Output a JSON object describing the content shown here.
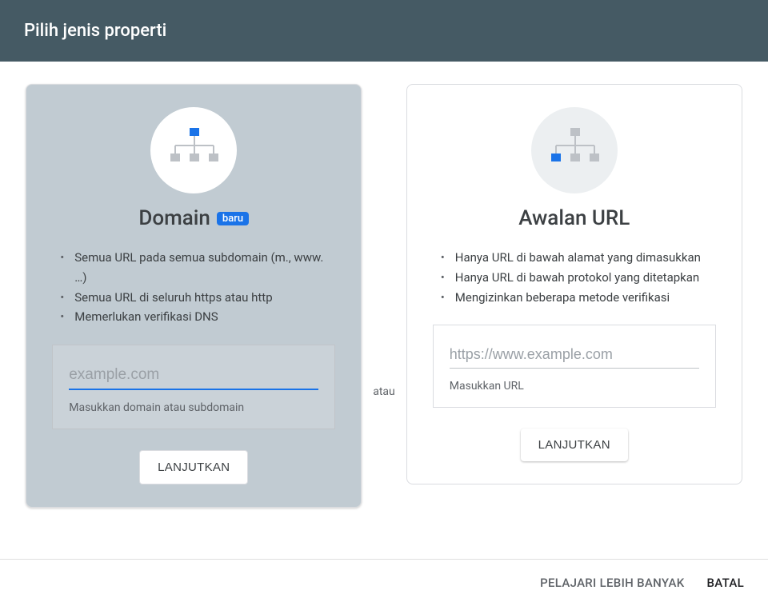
{
  "header": {
    "title": "Pilih jenis properti"
  },
  "separator": "atau",
  "domain_card": {
    "title": "Domain",
    "badge": "baru",
    "bullets": [
      "Semua URL pada semua subdomain (m., www. …)",
      "Semua URL di seluruh https atau http",
      "Memerlukan verifikasi DNS"
    ],
    "placeholder": "example.com",
    "helper": "Masukkan domain atau subdomain",
    "button": "LANJUTKAN"
  },
  "url_card": {
    "title": "Awalan URL",
    "bullets": [
      "Hanya URL di bawah alamat yang dimasukkan",
      "Hanya URL di bawah protokol yang ditetapkan",
      "Mengizinkan beberapa metode verifikasi"
    ],
    "placeholder": "https://www.example.com",
    "helper": "Masukkan URL",
    "button": "LANJUTKAN"
  },
  "footer": {
    "learn_more": "PELAJARI LEBIH BANYAK",
    "cancel": "BATAL"
  }
}
